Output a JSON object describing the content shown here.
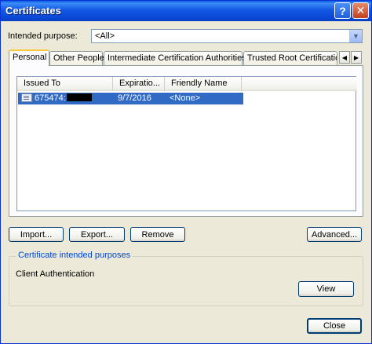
{
  "window": {
    "title": "Certificates",
    "help_glyph": "?",
    "close_glyph": "✕"
  },
  "intended_purpose": {
    "label": "Intended purpose:",
    "value": "<All>"
  },
  "tabs": [
    {
      "label": "Personal"
    },
    {
      "label": "Other People"
    },
    {
      "label": "Intermediate Certification Authorities"
    },
    {
      "label": "Trusted Root Certification"
    }
  ],
  "list": {
    "columns": [
      "Issued To",
      "Expiratio...",
      "Friendly Name"
    ],
    "rows": [
      {
        "issued_to": "675474:",
        "expiration": "9/7/2016",
        "friendly_name": "<None>"
      }
    ]
  },
  "buttons": {
    "import": "Import...",
    "export": "Export...",
    "remove": "Remove",
    "advanced": "Advanced...",
    "view": "View",
    "close": "Close"
  },
  "purposes": {
    "legend": "Certificate intended purposes",
    "value": "Client Authentication"
  },
  "colors": {
    "title_bar": "#0a47d4",
    "selection": "#316ac5",
    "window_bg": "#ece9d8"
  }
}
